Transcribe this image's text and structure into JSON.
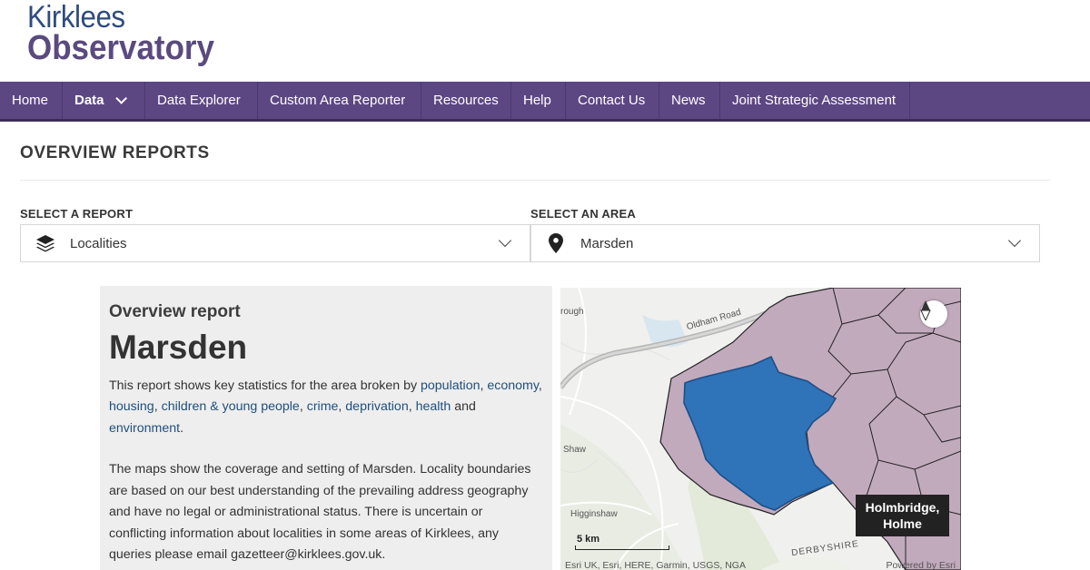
{
  "logo": {
    "line1": "Kirklees",
    "line2": "Observatory"
  },
  "nav": {
    "items": [
      {
        "label": "Home"
      },
      {
        "label": "Data"
      },
      {
        "label": "Data Explorer"
      },
      {
        "label": "Custom Area Reporter"
      },
      {
        "label": "Resources"
      },
      {
        "label": "Help"
      },
      {
        "label": "Contact Us"
      },
      {
        "label": "News"
      },
      {
        "label": "Joint Strategic Assessment"
      }
    ]
  },
  "page": {
    "title": "OVERVIEW REPORTS"
  },
  "report_select": {
    "label": "SELECT A REPORT",
    "value": "Localities",
    "icon": "layers-icon"
  },
  "area_select": {
    "label": "SELECT AN AREA",
    "value": "Marsden",
    "icon": "map-pin-icon"
  },
  "report": {
    "subtitle": "Overview report",
    "area_name": "Marsden",
    "intro_1": "This report shows key statistics for the area broken by ",
    "links": {
      "population": "population",
      "economy": "economy",
      "housing": "housing",
      "children": "children & young people",
      "crime": "crime",
      "deprivation": "deprivation",
      "health": "health",
      "environment": "environment"
    },
    "and": "and ",
    "para2": "The maps show the coverage and setting of Marsden.  Locality boundaries are based on our best understanding of the prevailing address geography and have no legal or administrational status. There is uncertain or conflicting information about localities in some areas of Kirklees, any queries please email gazetteer@kirklees.gov.uk."
  },
  "map": {
    "popup_line1": "Holmbridge,",
    "popup_line2": "Holme",
    "scale": "5 km",
    "attribution": "Esri UK, Esri, HERE, Garmin, USGS, NGA",
    "powered_by": "Powered by Esri",
    "labels": {
      "oldham_road": "Oldham Road",
      "rough": "rough",
      "shaw": "Shaw",
      "higginshaw": "Higginshaw",
      "derbyshire": "DERBYSHIRE"
    },
    "colors": {
      "selected_area": "#2f73b8",
      "other_areas": "#c2aabd",
      "boundary": "#222222"
    }
  }
}
